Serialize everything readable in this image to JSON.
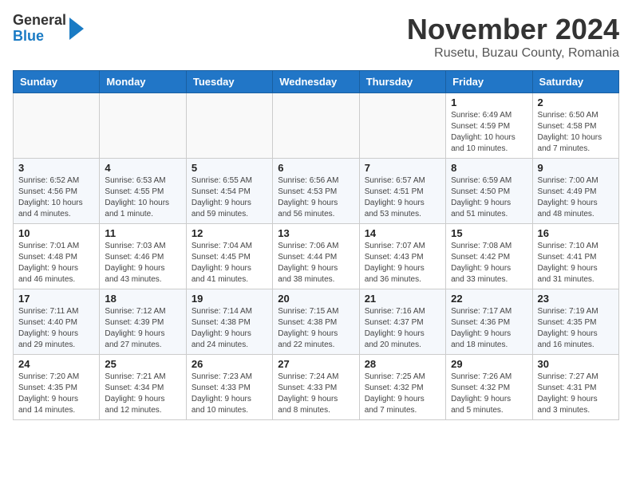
{
  "header": {
    "logo_line1": "General",
    "logo_line2": "Blue",
    "month_title": "November 2024",
    "location": "Rusetu, Buzau County, Romania"
  },
  "weekdays": [
    "Sunday",
    "Monday",
    "Tuesday",
    "Wednesday",
    "Thursday",
    "Friday",
    "Saturday"
  ],
  "weeks": [
    [
      {
        "day": null,
        "info": ""
      },
      {
        "day": null,
        "info": ""
      },
      {
        "day": null,
        "info": ""
      },
      {
        "day": null,
        "info": ""
      },
      {
        "day": null,
        "info": ""
      },
      {
        "day": "1",
        "info": "Sunrise: 6:49 AM\nSunset: 4:59 PM\nDaylight: 10 hours\nand 10 minutes."
      },
      {
        "day": "2",
        "info": "Sunrise: 6:50 AM\nSunset: 4:58 PM\nDaylight: 10 hours\nand 7 minutes."
      }
    ],
    [
      {
        "day": "3",
        "info": "Sunrise: 6:52 AM\nSunset: 4:56 PM\nDaylight: 10 hours\nand 4 minutes."
      },
      {
        "day": "4",
        "info": "Sunrise: 6:53 AM\nSunset: 4:55 PM\nDaylight: 10 hours\nand 1 minute."
      },
      {
        "day": "5",
        "info": "Sunrise: 6:55 AM\nSunset: 4:54 PM\nDaylight: 9 hours\nand 59 minutes."
      },
      {
        "day": "6",
        "info": "Sunrise: 6:56 AM\nSunset: 4:53 PM\nDaylight: 9 hours\nand 56 minutes."
      },
      {
        "day": "7",
        "info": "Sunrise: 6:57 AM\nSunset: 4:51 PM\nDaylight: 9 hours\nand 53 minutes."
      },
      {
        "day": "8",
        "info": "Sunrise: 6:59 AM\nSunset: 4:50 PM\nDaylight: 9 hours\nand 51 minutes."
      },
      {
        "day": "9",
        "info": "Sunrise: 7:00 AM\nSunset: 4:49 PM\nDaylight: 9 hours\nand 48 minutes."
      }
    ],
    [
      {
        "day": "10",
        "info": "Sunrise: 7:01 AM\nSunset: 4:48 PM\nDaylight: 9 hours\nand 46 minutes."
      },
      {
        "day": "11",
        "info": "Sunrise: 7:03 AM\nSunset: 4:46 PM\nDaylight: 9 hours\nand 43 minutes."
      },
      {
        "day": "12",
        "info": "Sunrise: 7:04 AM\nSunset: 4:45 PM\nDaylight: 9 hours\nand 41 minutes."
      },
      {
        "day": "13",
        "info": "Sunrise: 7:06 AM\nSunset: 4:44 PM\nDaylight: 9 hours\nand 38 minutes."
      },
      {
        "day": "14",
        "info": "Sunrise: 7:07 AM\nSunset: 4:43 PM\nDaylight: 9 hours\nand 36 minutes."
      },
      {
        "day": "15",
        "info": "Sunrise: 7:08 AM\nSunset: 4:42 PM\nDaylight: 9 hours\nand 33 minutes."
      },
      {
        "day": "16",
        "info": "Sunrise: 7:10 AM\nSunset: 4:41 PM\nDaylight: 9 hours\nand 31 minutes."
      }
    ],
    [
      {
        "day": "17",
        "info": "Sunrise: 7:11 AM\nSunset: 4:40 PM\nDaylight: 9 hours\nand 29 minutes."
      },
      {
        "day": "18",
        "info": "Sunrise: 7:12 AM\nSunset: 4:39 PM\nDaylight: 9 hours\nand 27 minutes."
      },
      {
        "day": "19",
        "info": "Sunrise: 7:14 AM\nSunset: 4:38 PM\nDaylight: 9 hours\nand 24 minutes."
      },
      {
        "day": "20",
        "info": "Sunrise: 7:15 AM\nSunset: 4:38 PM\nDaylight: 9 hours\nand 22 minutes."
      },
      {
        "day": "21",
        "info": "Sunrise: 7:16 AM\nSunset: 4:37 PM\nDaylight: 9 hours\nand 20 minutes."
      },
      {
        "day": "22",
        "info": "Sunrise: 7:17 AM\nSunset: 4:36 PM\nDaylight: 9 hours\nand 18 minutes."
      },
      {
        "day": "23",
        "info": "Sunrise: 7:19 AM\nSunset: 4:35 PM\nDaylight: 9 hours\nand 16 minutes."
      }
    ],
    [
      {
        "day": "24",
        "info": "Sunrise: 7:20 AM\nSunset: 4:35 PM\nDaylight: 9 hours\nand 14 minutes."
      },
      {
        "day": "25",
        "info": "Sunrise: 7:21 AM\nSunset: 4:34 PM\nDaylight: 9 hours\nand 12 minutes."
      },
      {
        "day": "26",
        "info": "Sunrise: 7:23 AM\nSunset: 4:33 PM\nDaylight: 9 hours\nand 10 minutes."
      },
      {
        "day": "27",
        "info": "Sunrise: 7:24 AM\nSunset: 4:33 PM\nDaylight: 9 hours\nand 8 minutes."
      },
      {
        "day": "28",
        "info": "Sunrise: 7:25 AM\nSunset: 4:32 PM\nDaylight: 9 hours\nand 7 minutes."
      },
      {
        "day": "29",
        "info": "Sunrise: 7:26 AM\nSunset: 4:32 PM\nDaylight: 9 hours\nand 5 minutes."
      },
      {
        "day": "30",
        "info": "Sunrise: 7:27 AM\nSunset: 4:31 PM\nDaylight: 9 hours\nand 3 minutes."
      }
    ]
  ]
}
